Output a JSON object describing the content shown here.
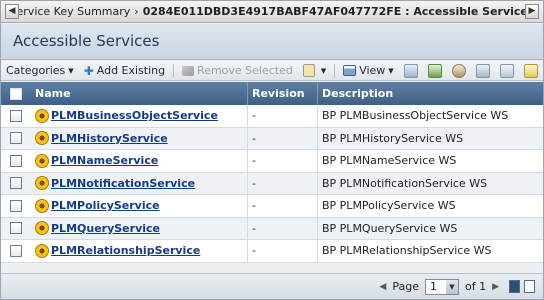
{
  "titlebar": {
    "prefix": "Service Key Summary",
    "separator": "›",
    "key": "0284E011DBD3E4917BABF47AF047772FE : Accessible Services"
  },
  "section": {
    "title": "Accessible Services"
  },
  "toolbar": {
    "categories": "Categories",
    "add_existing": "Add Existing",
    "remove_selected": "Remove Selected",
    "view": "View"
  },
  "table": {
    "headers": {
      "name": "Name",
      "revision": "Revision",
      "description": "Description"
    },
    "rows": [
      {
        "name": "PLMBusinessObjectService",
        "revision": "-",
        "description": "BP PLMBusinessObjectService WS"
      },
      {
        "name": "PLMHistoryService",
        "revision": "-",
        "description": "BP PLMHistoryService WS"
      },
      {
        "name": "PLMNameService",
        "revision": "-",
        "description": "BP PLMNameService WS"
      },
      {
        "name": "PLMNotificationService",
        "revision": "-",
        "description": "BP PLMNotificationService WS"
      },
      {
        "name": "PLMPolicyService",
        "revision": "-",
        "description": "BP PLMPolicyService WS"
      },
      {
        "name": "PLMQueryService",
        "revision": "-",
        "description": "BP PLMQueryService WS"
      },
      {
        "name": "PLMRelationshipService",
        "revision": "-",
        "description": "BP PLMRelationshipService WS"
      }
    ]
  },
  "pager": {
    "page_label": "Page",
    "page_value": "1",
    "of_label": "of 1"
  }
}
